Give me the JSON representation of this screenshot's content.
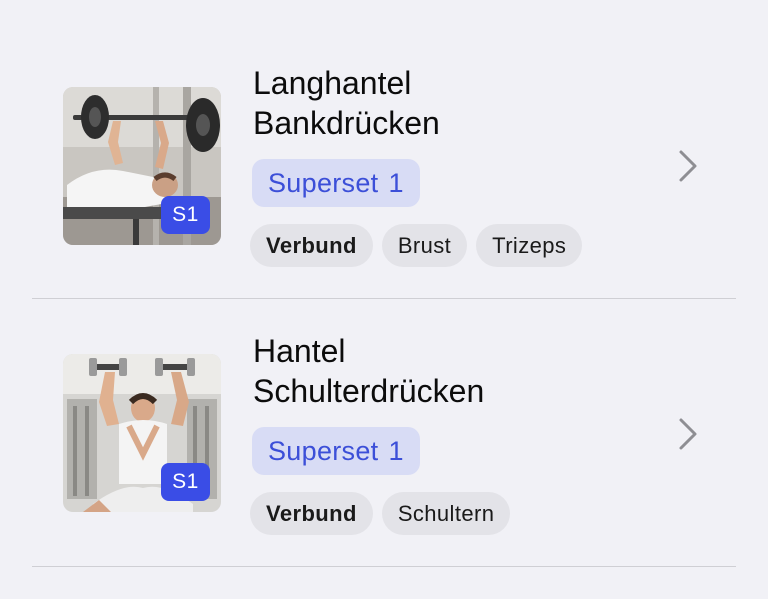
{
  "exercises": [
    {
      "title_line1": "Langhantel",
      "title_line2": "Bankdrücken",
      "image_badge": "S1",
      "superset_label": "Superset",
      "superset_number": "1",
      "tags": [
        "Verbund",
        "Brust",
        "Trizeps"
      ],
      "image": "barbell-bench-press-photo"
    },
    {
      "title_line1": "Hantel",
      "title_line2": "Schulterdrücken",
      "image_badge": "S1",
      "superset_label": "Superset",
      "superset_number": "1",
      "tags": [
        "Verbund",
        "Schultern"
      ],
      "image": "dumbbell-shoulder-press-photo"
    }
  ],
  "colors": {
    "background": "#f1f1f6",
    "accent": "#3a4de6",
    "superset_badge_bg": "#d8dcf5",
    "superset_badge_text": "#3c4fd8",
    "tag_bg": "#e3e3e8",
    "chevron": "#8e8e93"
  },
  "icons": {
    "row_disclosure": "chevron-right-icon"
  }
}
